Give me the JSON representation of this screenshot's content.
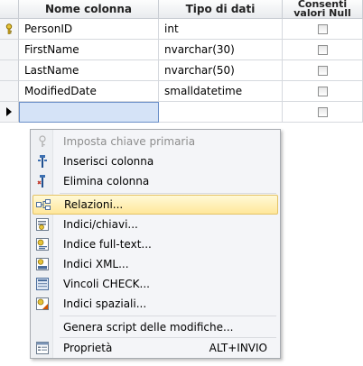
{
  "columns": {
    "name_header": "Nome colonna",
    "type_header": "Tipo di dati",
    "nulls_header_line1": "Consenti",
    "nulls_header_line2": "valori Null"
  },
  "rows": [
    {
      "name": "PersonID",
      "type": "int",
      "allow_nulls": false,
      "primary_key": true
    },
    {
      "name": "FirstName",
      "type": "nvarchar(30)",
      "allow_nulls": false
    },
    {
      "name": "LastName",
      "type": "nvarchar(50)",
      "allow_nulls": false
    },
    {
      "name": "ModifiedDate",
      "type": "smalldatetime",
      "allow_nulls": false
    },
    {
      "name": "",
      "type": "",
      "allow_nulls": false
    }
  ],
  "menu": {
    "items": [
      {
        "label": "Imposta chiave primaria",
        "icon": "key-icon",
        "enabled": false
      },
      {
        "label": "Inserisci colonna",
        "icon": "insert-column-icon"
      },
      {
        "label": "Elimina colonna",
        "icon": "delete-column-icon"
      },
      {
        "label": "Relazioni...",
        "icon": "relationships-icon",
        "highlighted": true
      },
      {
        "label": "Indici/chiavi...",
        "icon": "indexes-keys-icon"
      },
      {
        "label": "Indice full-text...",
        "icon": "fulltext-index-icon"
      },
      {
        "label": "Indici XML...",
        "icon": "xml-index-icon"
      },
      {
        "label": "Vincoli CHECK...",
        "icon": "check-constraint-icon"
      },
      {
        "label": "Indici spaziali...",
        "icon": "spatial-index-icon"
      },
      {
        "label": "Genera script delle modifiche...",
        "icon": "generate-script-icon"
      },
      {
        "label": "Proprietà",
        "icon": "properties-icon",
        "shortcut": "ALT+INVIO"
      }
    ]
  },
  "colors": {
    "menu_highlight": "#ffe79a",
    "selected_cell": "#d5e3f7"
  }
}
